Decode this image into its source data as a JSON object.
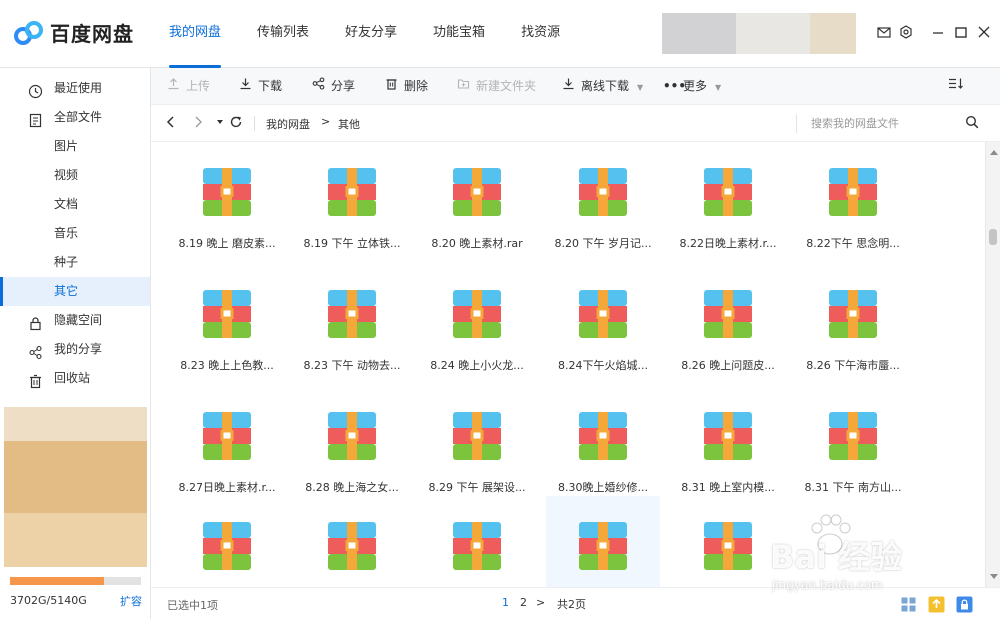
{
  "app": {
    "name": "百度网盘"
  },
  "nav": {
    "tabs": [
      {
        "label": "我的网盘"
      },
      {
        "label": "传输列表"
      },
      {
        "label": "好友分享"
      },
      {
        "label": "功能宝箱"
      },
      {
        "label": "找资源"
      }
    ],
    "active_tab": "我的网盘"
  },
  "titlebar_icons": [
    "mail-icon",
    "settings-icon",
    "minimize-icon",
    "maximize-icon",
    "close-icon"
  ],
  "sidebar": {
    "items": [
      {
        "label": "最近使用",
        "icon": "clock-icon"
      },
      {
        "label": "全部文件",
        "icon": "document-icon"
      },
      {
        "label": "图片"
      },
      {
        "label": "视频"
      },
      {
        "label": "文档"
      },
      {
        "label": "音乐"
      },
      {
        "label": "种子"
      },
      {
        "label": "其它"
      },
      {
        "label": "隐藏空间",
        "icon": "lock-icon"
      },
      {
        "label": "我的分享",
        "icon": "share-icon"
      },
      {
        "label": "回收站",
        "icon": "trash-icon"
      }
    ],
    "active_item": "其它",
    "quota": {
      "text": "3702G/5140G",
      "used_fraction": 0.72,
      "expand_label": "扩容"
    }
  },
  "toolbar": {
    "upload": "上传",
    "download": "下载",
    "share": "分享",
    "delete": "删除",
    "new_folder": "新建文件夹",
    "offline_download": "离线下载",
    "more": "更多"
  },
  "pathbar": {
    "crumbs": [
      "我的网盘",
      "其他"
    ],
    "separator": ">",
    "search_placeholder": "搜索我的网盘文件"
  },
  "files": [
    {
      "name": "8.19 晚上 磨皮素..."
    },
    {
      "name": "8.19 下午 立体铁..."
    },
    {
      "name": "8.20 晚上素材.rar"
    },
    {
      "name": "8.20 下午 岁月记..."
    },
    {
      "name": "8.22日晚上素材.r..."
    },
    {
      "name": "8.22下午 思念明..."
    },
    {
      "name": "8.23 晚上上色教..."
    },
    {
      "name": "8.23 下午 动物去..."
    },
    {
      "name": "8.24 晚上小火龙..."
    },
    {
      "name": "8.24下午火焰城..."
    },
    {
      "name": "8.26 晚上问题皮..."
    },
    {
      "name": "8.26 下午海市蜃..."
    },
    {
      "name": "8.27日晚上素材.r..."
    },
    {
      "name": "8.28 晚上海之女..."
    },
    {
      "name": "8.29 下午 展架设..."
    },
    {
      "name": "8.30晚上婚纱修..."
    },
    {
      "name": "8.31 晚上室内模..."
    },
    {
      "name": "8.31 下午 南方山..."
    },
    {
      "name": ""
    },
    {
      "name": ""
    },
    {
      "name": ""
    },
    {
      "name": ""
    },
    {
      "name": ""
    }
  ],
  "status": {
    "selected": "已选中1项",
    "pages": [
      "1",
      "2"
    ],
    "current_page": "1",
    "next": ">",
    "total": "共2页"
  },
  "watermark": {
    "text": "Bai 经验",
    "url": "jingyan.baidu.com"
  },
  "colors": {
    "accent": "#0b6ed8",
    "quota_fill": "#f5964a"
  }
}
